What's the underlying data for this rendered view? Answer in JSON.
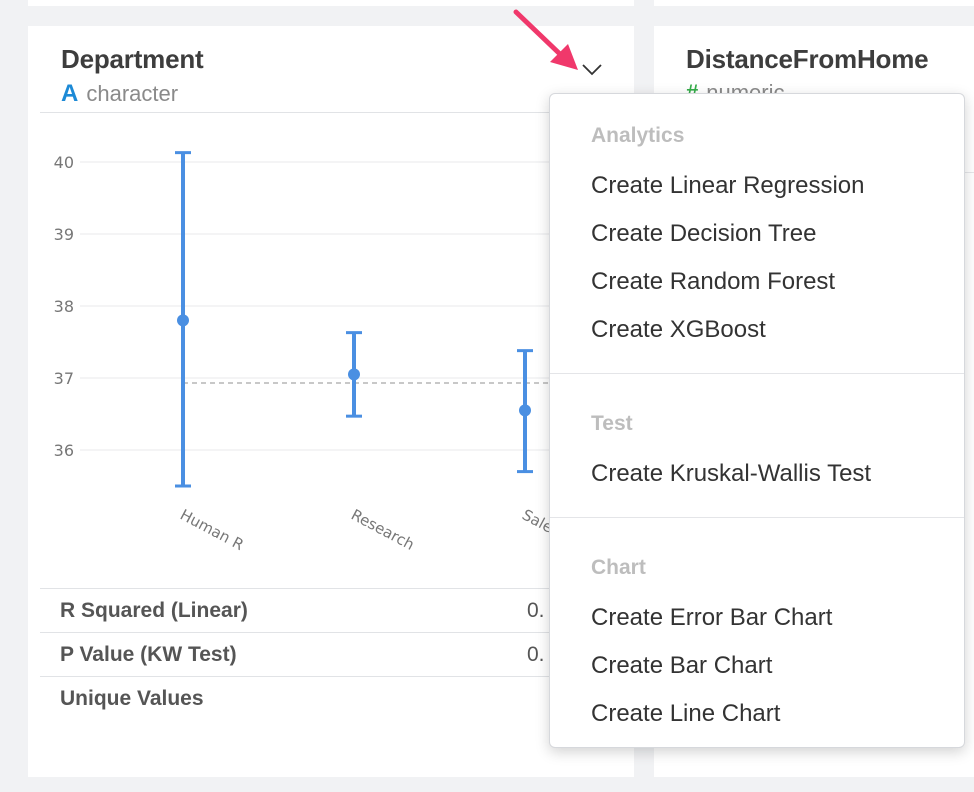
{
  "columns": {
    "department": {
      "name": "Department",
      "type_icon": "A",
      "type": "character"
    },
    "distance": {
      "name": "DistanceFromHome",
      "type_icon": "#",
      "type": "numeric"
    }
  },
  "chart_data": {
    "type": "error-bar",
    "categories": [
      "Human R",
      "Research",
      "Sales"
    ],
    "means": [
      37.8,
      37.05,
      36.55
    ],
    "lower": [
      35.5,
      36.47,
      35.7
    ],
    "upper": [
      40.13,
      37.63,
      37.38
    ],
    "overall_mean": 36.93,
    "yticks": [
      36,
      37,
      38,
      39,
      40
    ],
    "ylim": [
      35.0,
      40.5
    ],
    "color": "#4a8fe2",
    "grid": true
  },
  "stats": [
    {
      "label": "R Squared (Linear)",
      "value": "0."
    },
    {
      "label": "P Value (KW Test)",
      "value": "0."
    },
    {
      "label": "Unique Values",
      "value": ""
    }
  ],
  "menu": {
    "sections": [
      {
        "header": "Analytics",
        "items": [
          "Create Linear Regression",
          "Create Decision Tree",
          "Create Random Forest",
          "Create XGBoost"
        ]
      },
      {
        "header": "Test",
        "items": [
          "Create Kruskal-Wallis Test"
        ]
      },
      {
        "header": "Chart",
        "items": [
          "Create Error Bar Chart",
          "Create Bar Chart",
          "Create Line Chart"
        ]
      }
    ]
  },
  "colors": {
    "accent_arrow": "#f0386b",
    "type_character": "#1d8ad6",
    "type_numeric": "#35ad4a"
  }
}
